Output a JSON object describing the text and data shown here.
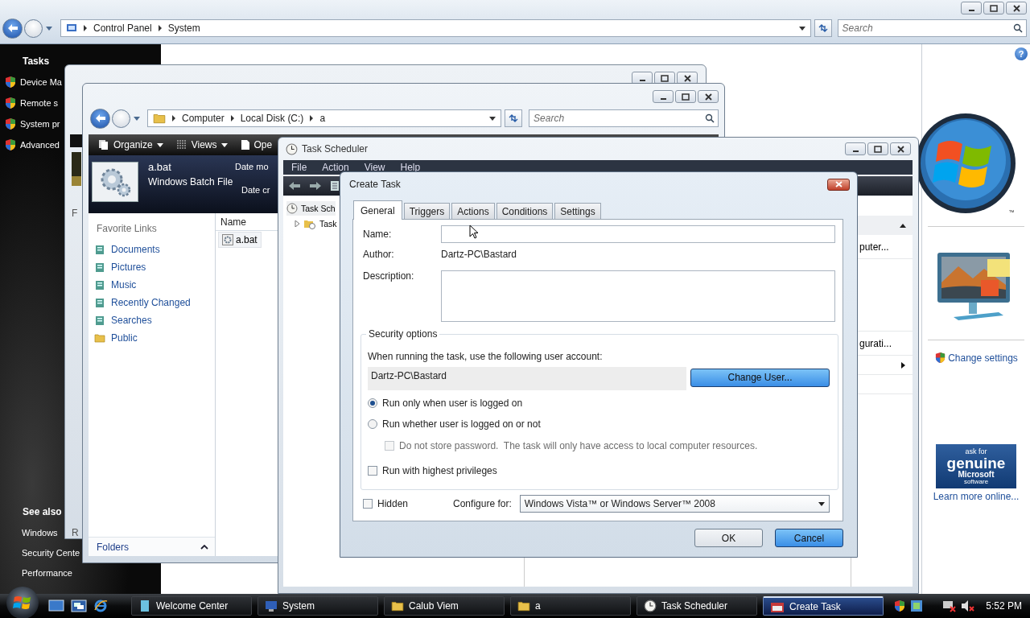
{
  "control_panel": {
    "breadcrumb": [
      "Control Panel",
      "System"
    ],
    "search": {
      "placeholder": "Search"
    },
    "help": "?",
    "tasks_heading": "Tasks",
    "tasks": [
      "Device Ma",
      "Remote s",
      "System pr",
      "Advanced"
    ],
    "see_also_heading": "See also",
    "see_also": [
      "Windows",
      "Security Cente",
      "Performance"
    ],
    "logo_mark": "™",
    "change_settings": "Change settings",
    "genuine_badge": [
      "ask for",
      "genuine",
      "Microsoft",
      "software"
    ],
    "learn_more": "Learn more online..."
  },
  "back_window": {
    "fragments": [
      "F",
      "R"
    ]
  },
  "explorer": {
    "breadcrumb": [
      "Computer",
      "Local Disk (C:)",
      "a"
    ],
    "search": {
      "placeholder": "Search"
    },
    "toolbar": [
      "Organize",
      "Views",
      "Ope"
    ],
    "details": {
      "name": "a.bat",
      "type": "Windows Batch File",
      "field_1": "Date mo",
      "field_2": "Date cr"
    },
    "favorites_heading": "Favorite Links",
    "favorites": [
      "Documents",
      "Pictures",
      "Music",
      "Recently Changed",
      "Searches",
      "Public"
    ],
    "folders": "Folders",
    "column": "Name",
    "files": [
      "a.bat"
    ]
  },
  "task_scheduler": {
    "title": "Task Scheduler",
    "menu": [
      "File",
      "Action",
      "View",
      "Help"
    ],
    "tree": [
      {
        "label": "Task Sch",
        "children": [
          {
            "label": "Task",
            "expanded": false
          }
        ]
      }
    ],
    "actions": [
      "puter...",
      "gurati..."
    ]
  },
  "create_task": {
    "title": "Create Task",
    "tabs": [
      {
        "label": "General",
        "selected": true
      },
      {
        "label": "Triggers",
        "selected": false
      },
      {
        "label": "Actions",
        "selected": false
      },
      {
        "label": "Conditions",
        "selected": false
      },
      {
        "label": "Settings",
        "selected": false
      }
    ],
    "name": {
      "label": "Name:"
    },
    "author": {
      "label": "Author:",
      "value": "Dartz-PC\\Bastard"
    },
    "description": {
      "label": "Description:"
    },
    "security": {
      "heading": "Security options",
      "account_prompt": "When running the task, use the following user account:",
      "account": "Dartz-PC\\Bastard",
      "change_button": {
        "label": "Change User...",
        "highlighted": true
      },
      "run_options": [
        {
          "label": "Run only when user is logged on",
          "selected": true
        },
        {
          "label": "Run whether user is logged on or not",
          "selected": false
        }
      ],
      "store_password": {
        "label": "Do not store password.  The task will only have access to local computer resources.",
        "checked": false,
        "disabled": true
      },
      "highest": {
        "label": "Run with highest privileges",
        "checked": false
      }
    },
    "hidden": {
      "label": "Hidden",
      "checked": false
    },
    "configure": {
      "label": "Configure for:",
      "value": "Windows Vista™ or Windows Server™ 2008"
    },
    "buttons": [
      {
        "label": "OK",
        "highlighted": false
      },
      {
        "label": "Cancel",
        "highlighted": true
      }
    ]
  },
  "taskbar": {
    "items": [
      {
        "label": "Welcome Center",
        "selected": false
      },
      {
        "label": "System",
        "selected": false
      },
      {
        "label": "Calub Viem",
        "selected": false
      },
      {
        "label": "a",
        "selected": false
      },
      {
        "label": "Task Scheduler",
        "selected": false
      },
      {
        "label": "Create Task",
        "selected": true
      }
    ],
    "clock": "5:52 PM"
  }
}
